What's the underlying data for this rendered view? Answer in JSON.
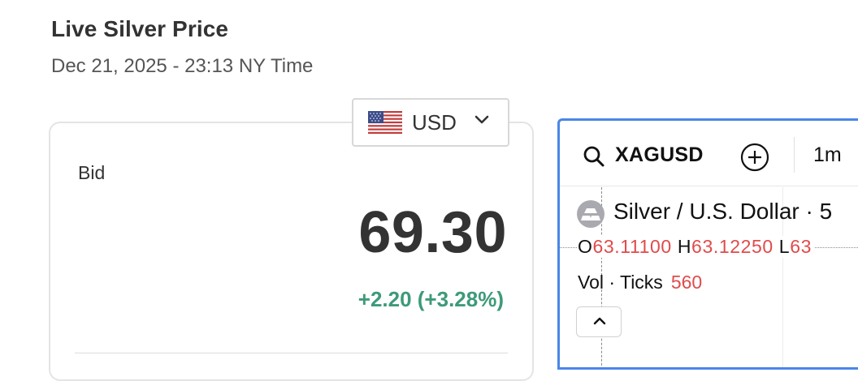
{
  "header": {
    "title": "Live Silver Price",
    "subtitle": "Dec 21, 2025 - 23:13 NY Time"
  },
  "currency": {
    "selected": "USD",
    "flag_icon": "us-flag-icon",
    "chevron_icon": "chevron-down-icon"
  },
  "price_card": {
    "bid_label": "Bid",
    "bid_value": "69.30",
    "change": "+2.20 (+3.28%)",
    "change_color": "#3e9a78"
  },
  "chart_widget": {
    "accent_color": "#4a86e8",
    "search_icon": "search-icon",
    "symbol": "XAGUSD",
    "add_icon": "plus-circle-icon",
    "interval": "1m",
    "instrument_icon": "silver-bars-icon",
    "instrument_name": "Silver / U.S. Dollar · 5",
    "ohlc": [
      {
        "key": "O",
        "value": "63.11100"
      },
      {
        "key": "H",
        "value": "63.12250"
      },
      {
        "key": "L",
        "value": "63"
      }
    ],
    "value_color": "#e04b4b",
    "volume_label": "Vol · Ticks",
    "volume_value": "560",
    "collapse_icon": "chevron-up-icon"
  }
}
